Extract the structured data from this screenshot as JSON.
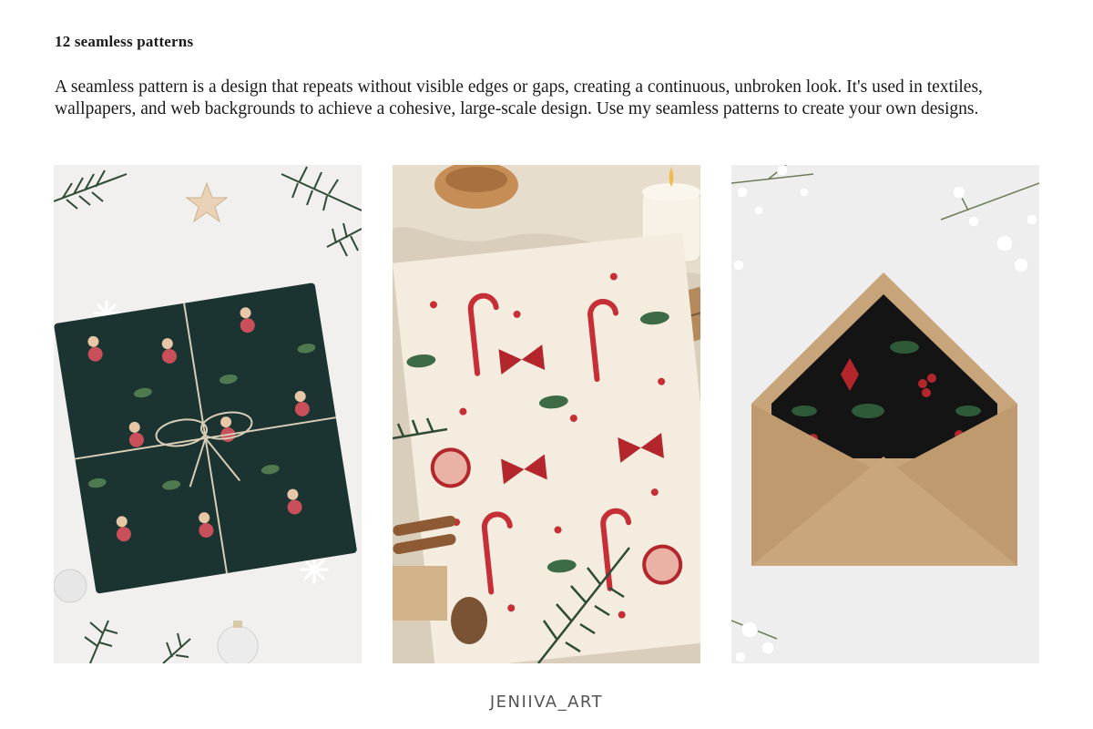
{
  "heading": "12 seamless patterns",
  "description": "A seamless pattern is a design that repeats without visible edges or gaps, creating a continuous, unbroken look. It's used in textiles, wallpapers, and web backgrounds to achieve a cohesive, large-scale design. Use my seamless patterns to create your own designs.",
  "logo": "JENIIVA_ART",
  "colors": {
    "text": "#1a1a1a",
    "dark_green_paper": "#1b3431",
    "cream_paper": "#f3ecdf",
    "kraft": "#c7a47a",
    "black_liner": "#141414",
    "pine": "#2f4a35",
    "red": "#b3262c"
  }
}
